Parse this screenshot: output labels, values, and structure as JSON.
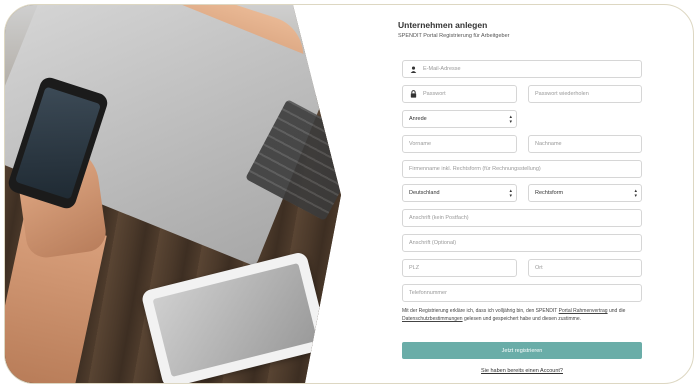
{
  "header": {
    "title": "Unternehmen anlegen",
    "subtitle": "SPENDIT Portal Registrierung für Arbeitgeber"
  },
  "form": {
    "email_placeholder": "E-Mail-Adresse",
    "password_placeholder": "Passwort",
    "password_repeat_placeholder": "Passwort wiederholen",
    "salutation_value": "Anrede",
    "firstname_placeholder": "Vorname",
    "lastname_placeholder": "Nachname",
    "company_placeholder": "Firmenname inkl. Rechtsform (für Rechnungsstellung)",
    "country_value": "Deutschland",
    "legalform_value": "Rechtsform",
    "address_placeholder": "Anschrift (kein Postfach)",
    "address2_placeholder": "Anschrift (Optional)",
    "zip_placeholder": "PLZ",
    "city_placeholder": "Ort",
    "phone_placeholder": "Telefonnummer"
  },
  "legal": {
    "text_before": "Mit der Registrierung erkläre ich, dass ich volljährig bin, den SPENDIT",
    "contract_link": "Portal Rahmenvertrag",
    "text_middle": "und die",
    "privacy_link": "Datenschutzbestimmungen",
    "text_after": "gelesen und gespeichert habe und diesen zustimme."
  },
  "actions": {
    "submit_label": "Jetzt registrieren",
    "login_link": "Sie haben bereits einen Account?"
  },
  "icons": {
    "email": "user-icon",
    "password": "lock-icon",
    "select": "updown-arrows-icon"
  },
  "colors": {
    "accent": "#6aada8",
    "card_border": "#ddd7c2"
  }
}
